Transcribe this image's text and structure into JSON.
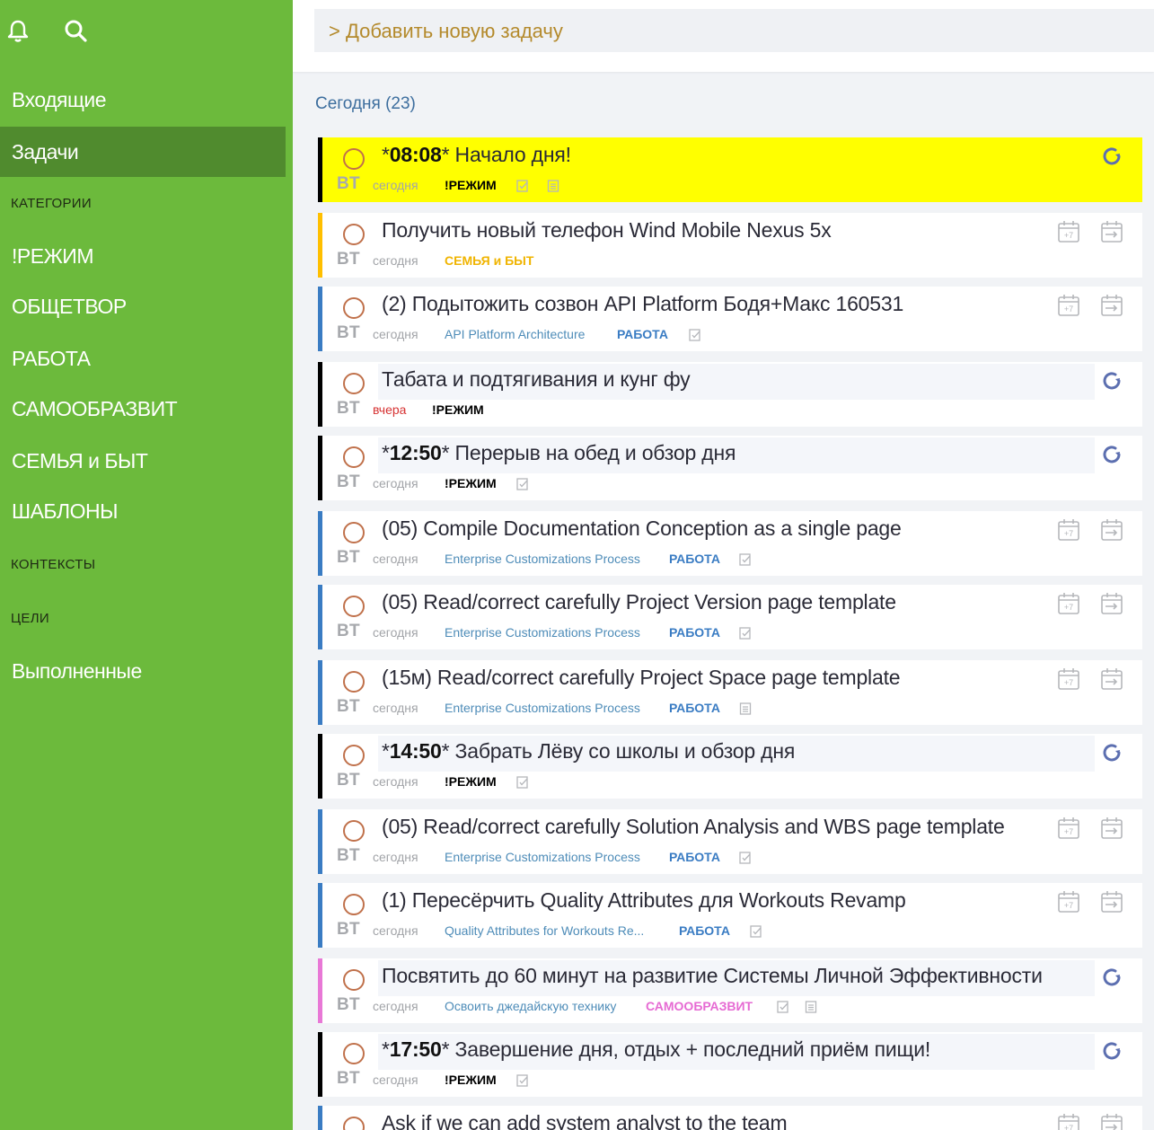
{
  "sidebar": {
    "items": [
      {
        "label": "Входящие"
      },
      {
        "label": "Задачи"
      },
      {
        "label": "КАТЕГОРИИ"
      },
      {
        "label": "!РЕЖИМ"
      },
      {
        "label": "ОБЩЕТВОР"
      },
      {
        "label": "РАБОТА"
      },
      {
        "label": "САМООБРАЗВИТ"
      },
      {
        "label": "СЕМЬЯ и БЫТ"
      },
      {
        "label": "ШАБЛОНЫ"
      },
      {
        "label": "КОНТЕКСТЫ"
      },
      {
        "label": "ЦЕЛИ"
      },
      {
        "label": "Выполненные"
      }
    ]
  },
  "add_task": {
    "label": "> Добавить новую задачу"
  },
  "section": {
    "title": "Сегодня (23)"
  },
  "colors": {
    "sidebar": "#6cba3c",
    "sidebar_active": "#508b2e",
    "highlight": "#ffff00",
    "work": "#3a7cc3",
    "family": "#ffbf00",
    "selfdev": "#e878d6",
    "mode": "#000000"
  },
  "tasks": [
    {
      "time": "08:08",
      "title": " Начало дня!",
      "day": "ВТ",
      "date": "сегодня",
      "project": "",
      "category": "!РЕЖИМ"
    },
    {
      "time": "",
      "title": "Получить новый телефон Wind Mobile Nexus 5x",
      "day": "ВТ",
      "date": "сегодня",
      "project": "",
      "category": "СЕМЬЯ и БЫТ"
    },
    {
      "time": "",
      "title": "(2) Подытожить созвон API Platform Бодя+Макс 160531",
      "day": "ВТ",
      "date": "сегодня",
      "project": "API Platform Architecture",
      "category": "РАБОТА"
    },
    {
      "time": "",
      "title": "Табата и подтягивания и кунг фу",
      "day": "ВТ",
      "date": "вчера",
      "project": "",
      "category": "!РЕЖИМ"
    },
    {
      "time": "12:50",
      "title": " Перерыв на обед и обзор дня",
      "day": "ВТ",
      "date": "сегодня",
      "project": "",
      "category": "!РЕЖИМ"
    },
    {
      "time": "",
      "title": "(05) Compile Documentation Conception as a single page",
      "day": "ВТ",
      "date": "сегодня",
      "project": "Enterprise Customizations Process",
      "category": "РАБОТА"
    },
    {
      "time": "",
      "title": "(05) Read/correct carefully Project Version page template",
      "day": "ВТ",
      "date": "сегодня",
      "project": "Enterprise Customizations Process",
      "category": "РАБОТА"
    },
    {
      "time": "",
      "title": "(15м) Read/correct carefully Project Space page template",
      "day": "ВТ",
      "date": "сегодня",
      "project": "Enterprise Customizations Process",
      "category": "РАБОТА"
    },
    {
      "time": "14:50",
      "title": " Забрать Лёву со школы и обзор дня",
      "day": "ВТ",
      "date": "сегодня",
      "project": "",
      "category": "!РЕЖИМ"
    },
    {
      "time": "",
      "title": "(05) Read/correct carefully Solution Analysis and WBS page template",
      "day": "ВТ",
      "date": "сегодня",
      "project": "Enterprise Customizations Process",
      "category": "РАБОТА"
    },
    {
      "time": "",
      "title": "(1) Пересёрчить Quality Attributes для Workouts Revamp",
      "day": "ВТ",
      "date": "сегодня",
      "project": "Quality Attributes for Workouts Re...",
      "category": "РАБОТА"
    },
    {
      "time": "",
      "title": "Посвятить до 60 минут на развитие Системы Личной Эффективности",
      "day": "ВТ",
      "date": "сегодня",
      "project": "Освоить джедайскую технику",
      "category": "САМООБРАЗВИТ"
    },
    {
      "time": "17:50",
      "title": " Завершение дня, отдых + последний приём пищи!",
      "day": "ВТ",
      "date": "сегодня",
      "project": "",
      "category": "!РЕЖИМ"
    },
    {
      "time": "",
      "title": "Ask if we can add system analyst to the team",
      "day": "",
      "date": "",
      "project": "",
      "category": ""
    }
  ]
}
